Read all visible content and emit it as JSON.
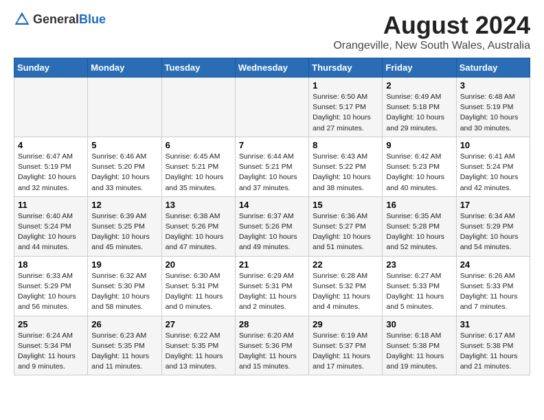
{
  "logo": {
    "text_general": "General",
    "text_blue": "Blue"
  },
  "title": "August 2024",
  "subtitle": "Orangeville, New South Wales, Australia",
  "days_of_week": [
    "Sunday",
    "Monday",
    "Tuesday",
    "Wednesday",
    "Thursday",
    "Friday",
    "Saturday"
  ],
  "weeks": [
    [
      {
        "day": "",
        "info": ""
      },
      {
        "day": "",
        "info": ""
      },
      {
        "day": "",
        "info": ""
      },
      {
        "day": "",
        "info": ""
      },
      {
        "day": "1",
        "info": "Sunrise: 6:50 AM\nSunset: 5:17 PM\nDaylight: 10 hours\nand 27 minutes."
      },
      {
        "day": "2",
        "info": "Sunrise: 6:49 AM\nSunset: 5:18 PM\nDaylight: 10 hours\nand 29 minutes."
      },
      {
        "day": "3",
        "info": "Sunrise: 6:48 AM\nSunset: 5:19 PM\nDaylight: 10 hours\nand 30 minutes."
      }
    ],
    [
      {
        "day": "4",
        "info": "Sunrise: 6:47 AM\nSunset: 5:19 PM\nDaylight: 10 hours\nand 32 minutes."
      },
      {
        "day": "5",
        "info": "Sunrise: 6:46 AM\nSunset: 5:20 PM\nDaylight: 10 hours\nand 33 minutes."
      },
      {
        "day": "6",
        "info": "Sunrise: 6:45 AM\nSunset: 5:21 PM\nDaylight: 10 hours\nand 35 minutes."
      },
      {
        "day": "7",
        "info": "Sunrise: 6:44 AM\nSunset: 5:21 PM\nDaylight: 10 hours\nand 37 minutes."
      },
      {
        "day": "8",
        "info": "Sunrise: 6:43 AM\nSunset: 5:22 PM\nDaylight: 10 hours\nand 38 minutes."
      },
      {
        "day": "9",
        "info": "Sunrise: 6:42 AM\nSunset: 5:23 PM\nDaylight: 10 hours\nand 40 minutes."
      },
      {
        "day": "10",
        "info": "Sunrise: 6:41 AM\nSunset: 5:24 PM\nDaylight: 10 hours\nand 42 minutes."
      }
    ],
    [
      {
        "day": "11",
        "info": "Sunrise: 6:40 AM\nSunset: 5:24 PM\nDaylight: 10 hours\nand 44 minutes."
      },
      {
        "day": "12",
        "info": "Sunrise: 6:39 AM\nSunset: 5:25 PM\nDaylight: 10 hours\nand 45 minutes."
      },
      {
        "day": "13",
        "info": "Sunrise: 6:38 AM\nSunset: 5:26 PM\nDaylight: 10 hours\nand 47 minutes."
      },
      {
        "day": "14",
        "info": "Sunrise: 6:37 AM\nSunset: 5:26 PM\nDaylight: 10 hours\nand 49 minutes."
      },
      {
        "day": "15",
        "info": "Sunrise: 6:36 AM\nSunset: 5:27 PM\nDaylight: 10 hours\nand 51 minutes."
      },
      {
        "day": "16",
        "info": "Sunrise: 6:35 AM\nSunset: 5:28 PM\nDaylight: 10 hours\nand 52 minutes."
      },
      {
        "day": "17",
        "info": "Sunrise: 6:34 AM\nSunset: 5:29 PM\nDaylight: 10 hours\nand 54 minutes."
      }
    ],
    [
      {
        "day": "18",
        "info": "Sunrise: 6:33 AM\nSunset: 5:29 PM\nDaylight: 10 hours\nand 56 minutes."
      },
      {
        "day": "19",
        "info": "Sunrise: 6:32 AM\nSunset: 5:30 PM\nDaylight: 10 hours\nand 58 minutes."
      },
      {
        "day": "20",
        "info": "Sunrise: 6:30 AM\nSunset: 5:31 PM\nDaylight: 11 hours\nand 0 minutes."
      },
      {
        "day": "21",
        "info": "Sunrise: 6:29 AM\nSunset: 5:31 PM\nDaylight: 11 hours\nand 2 minutes."
      },
      {
        "day": "22",
        "info": "Sunrise: 6:28 AM\nSunset: 5:32 PM\nDaylight: 11 hours\nand 4 minutes."
      },
      {
        "day": "23",
        "info": "Sunrise: 6:27 AM\nSunset: 5:33 PM\nDaylight: 11 hours\nand 5 minutes."
      },
      {
        "day": "24",
        "info": "Sunrise: 6:26 AM\nSunset: 5:33 PM\nDaylight: 11 hours\nand 7 minutes."
      }
    ],
    [
      {
        "day": "25",
        "info": "Sunrise: 6:24 AM\nSunset: 5:34 PM\nDaylight: 11 hours\nand 9 minutes."
      },
      {
        "day": "26",
        "info": "Sunrise: 6:23 AM\nSunset: 5:35 PM\nDaylight: 11 hours\nand 11 minutes."
      },
      {
        "day": "27",
        "info": "Sunrise: 6:22 AM\nSunset: 5:35 PM\nDaylight: 11 hours\nand 13 minutes."
      },
      {
        "day": "28",
        "info": "Sunrise: 6:20 AM\nSunset: 5:36 PM\nDaylight: 11 hours\nand 15 minutes."
      },
      {
        "day": "29",
        "info": "Sunrise: 6:19 AM\nSunset: 5:37 PM\nDaylight: 11 hours\nand 17 minutes."
      },
      {
        "day": "30",
        "info": "Sunrise: 6:18 AM\nSunset: 5:38 PM\nDaylight: 11 hours\nand 19 minutes."
      },
      {
        "day": "31",
        "info": "Sunrise: 6:17 AM\nSunset: 5:38 PM\nDaylight: 11 hours\nand 21 minutes."
      }
    ]
  ]
}
